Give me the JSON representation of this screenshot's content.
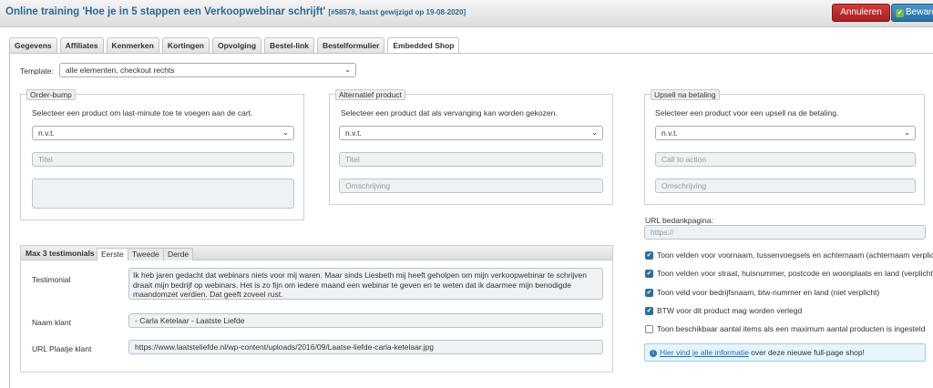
{
  "header": {
    "title": "Online training 'Hoe je in 5 stappen een Verkoopwebinar schrijft'",
    "meta": "[#58578, laatst gewijzigd op 19-08-2020]",
    "cancel_label": "Annuleren",
    "save_label": "Beward"
  },
  "tabs": [
    "Gegevens",
    "Affiliates",
    "Kenmerken",
    "Kortingen",
    "Opvolging",
    "Bestel-link",
    "Bestelformulier",
    "Embedded Shop"
  ],
  "active_tab": "Embedded Shop",
  "template": {
    "label": "Template:",
    "value": "alle elementen, checkout rechts"
  },
  "order_bump": {
    "legend": "Order-bump",
    "description": "Selecteer een product om last-minute toe te voegen aan de cart.",
    "select_value": "n.v.t.",
    "title_placeholder": "Titel",
    "textarea_value": ""
  },
  "alternative": {
    "legend": "Alternatief product",
    "description": "Selecteer een product dat als vervanging kan worden gekozen.",
    "select_value": "n.v.t.",
    "title_placeholder": "Titel",
    "description_placeholder": "Omschrijving"
  },
  "upsell": {
    "legend": "Upsell na betaling",
    "description": "Selecteer een product voor een upsell na de betaling.",
    "select_value": "n.v.t.",
    "cta_placeholder": "Call to action",
    "description_placeholder": "Omschrijving"
  },
  "thank_you": {
    "label": "URL bedankpagina:",
    "placeholder": "https://"
  },
  "options": [
    {
      "label": "Toon velden voor voornaam, tussenvoegsels en achternaam (achternaam verplicht)",
      "checked": true
    },
    {
      "label": "Toon velden voor straat, huisnummer, postcode en woonplaats en land (verplicht)",
      "checked": true
    },
    {
      "label": "Toon veld voor bedrijfsnaam, btw-nummer en land (niet verplicht)",
      "checked": true
    },
    {
      "label": "BTW voor dit product mag worden verlegd",
      "checked": true
    },
    {
      "label": "Toon beschikbaar aantal items als een maximum aantal producten is ingesteld",
      "checked": false
    }
  ],
  "info": {
    "link_text": "Hier vind je alle informatie",
    "rest_text": " over deze nieuwe full-page shop!"
  },
  "testimonials": {
    "title": "Max 3 testimonials",
    "tabs": [
      "Eerste",
      "Tweede",
      "Derde"
    ],
    "active_tab": "Eerste",
    "testimonial_label": "Testimonial",
    "testimonial_value": "Ik heb jaren gedacht dat webinars niets voor mij waren. Maar sinds Liesbeth mij heeft geholpen om mijn verkoopwebinar te schrijven draait mijn bedrijf op webinars. Het is zo fijn om iedere maand een webinar te geven en te weten dat ik daarmee mijn benodigde maandomzet verdien. Dat geeft zoveel rust.",
    "name_label": "Naam klant",
    "name_value": "- Carla Ketelaar - Laatste Liefde",
    "url_label": "URL Plaatje klant",
    "url_value": "https://www.laatsteliefde.nl/wp-content/uploads/2016/09/Laatse-liefde-carla-ketelaar.jpg"
  }
}
